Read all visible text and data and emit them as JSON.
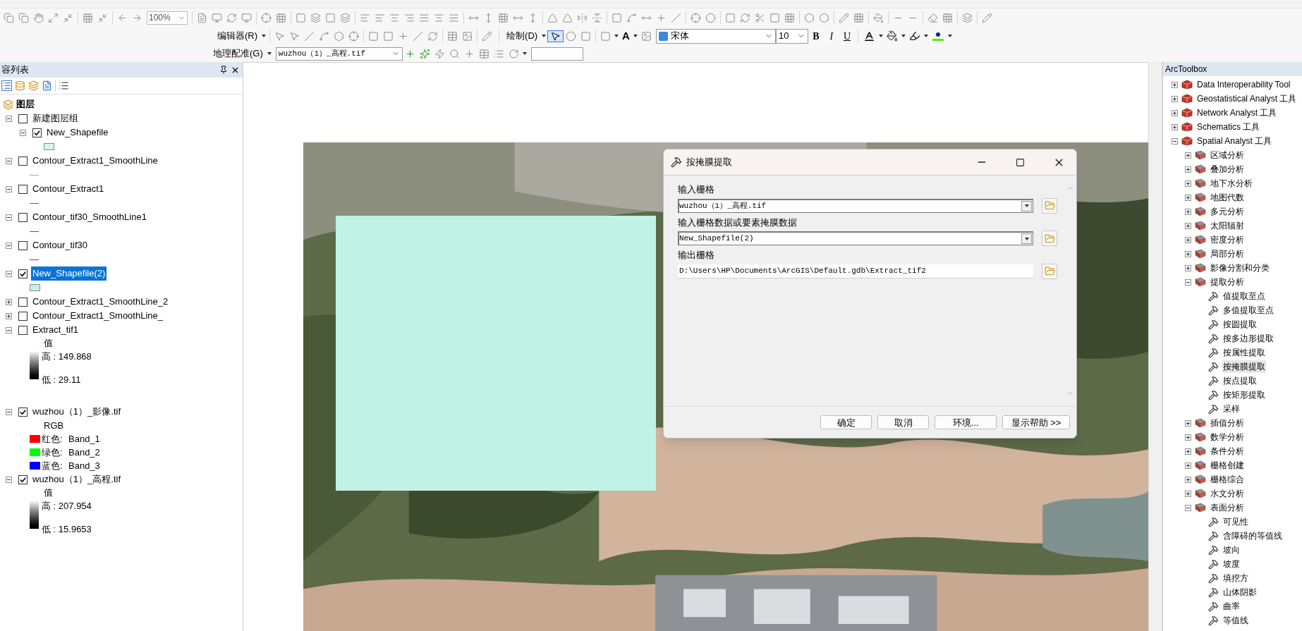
{
  "toolbar": {
    "zoom": "100%",
    "editor_menu": "编辑器(R)",
    "draw_menu": "绘制(D)",
    "text_tool": "A",
    "font": "宋体",
    "font_size": "10",
    "format": [
      "B",
      "I",
      "U"
    ],
    "georef_menu": "地理配准(G)",
    "georef_layer": "wuzhou（1）_高程.tif"
  },
  "toc": {
    "title": "容列表",
    "root": "图层",
    "layers": [
      {
        "name": "新建图层组",
        "kind": "group",
        "expanded": true,
        "checked": false,
        "selected": false,
        "children": [
          {
            "name": "New_Shapefile",
            "kind": "fill",
            "expanded": true,
            "checked": true,
            "selected": false,
            "color": "#d2f5f5"
          }
        ]
      },
      {
        "name": "Contour_Extract1_SmoothLine",
        "kind": "line",
        "expanded": true,
        "checked": false,
        "selected": false,
        "color": "#a8a8a8"
      },
      {
        "name": "Contour_Extract1",
        "kind": "line",
        "expanded": true,
        "checked": false,
        "selected": false,
        "color": "#c0401c"
      },
      {
        "name": "Contour_tif30_SmoothLine1",
        "kind": "line",
        "expanded": true,
        "checked": false,
        "selected": false,
        "color": "#a0420e"
      },
      {
        "name": "Contour_tif30",
        "kind": "line",
        "expanded": true,
        "checked": false,
        "selected": false,
        "color": "#c01870"
      },
      {
        "name": "New_Shapefile(2)",
        "kind": "fill",
        "expanded": true,
        "checked": true,
        "selected": true,
        "color": "#c2f2e2"
      },
      {
        "name": "Contour_Extract1_SmoothLine_2",
        "expanded": false,
        "checked": false,
        "selected": false
      },
      {
        "name": "Contour_Extract1_SmoothLine_",
        "expanded": false,
        "checked": false,
        "selected": false
      },
      {
        "name": "Extract_tif1",
        "kind": "stretch",
        "expanded": true,
        "checked": false,
        "selected": false,
        "field": "值",
        "high": "高 : 149.868",
        "low": "低 : 29.11"
      },
      {
        "name": "wuzhou（1）_影像.tif",
        "kind": "rgb",
        "expanded": true,
        "checked": true,
        "selected": false,
        "title": "RGB",
        "bands": [
          {
            "color": "#ff0000",
            "channel": "红色:",
            "band": "Band_1"
          },
          {
            "color": "#00ff00",
            "channel": "绿色:",
            "band": "Band_2"
          },
          {
            "color": "#0000ff",
            "channel": "蓝色:",
            "band": "Band_3"
          }
        ]
      },
      {
        "name": "wuzhou（1）_高程.tif",
        "kind": "stretch",
        "expanded": true,
        "checked": true,
        "selected": false,
        "field": "值",
        "high": "高 : 207.954",
        "low": "低 : 15.9653"
      }
    ]
  },
  "dialog": {
    "title": "按掩膜提取",
    "params": [
      {
        "label": "输入栅格",
        "value": "wuzhou（1）_高程.tif",
        "kind": "combo"
      },
      {
        "label": "输入栅格数据或要素掩膜数据",
        "value": "New_Shapefile(2)",
        "kind": "combo"
      },
      {
        "label": "输出栅格",
        "value": "D:\\Users\\HP\\Documents\\ArcGIS\\Default.gdb\\Extract_tif2",
        "kind": "text"
      }
    ],
    "buttons": [
      "确定",
      "取消",
      "环境...",
      "显示帮助 >>"
    ]
  },
  "toolbox": {
    "title": "ArcToolbox",
    "items": [
      {
        "name": "Data Interoperability Tool",
        "kind": "toolbox",
        "expanded": false
      },
      {
        "name": "Geostatistical Analyst 工具",
        "kind": "toolbox",
        "expanded": false
      },
      {
        "name": "Network Analyst 工具",
        "kind": "toolbox",
        "expanded": false
      },
      {
        "name": "Schematics 工具",
        "kind": "toolbox",
        "expanded": false
      },
      {
        "name": "Spatial Analyst 工具",
        "kind": "toolbox",
        "expanded": true,
        "children": [
          {
            "name": "区域分析",
            "kind": "toolset",
            "expanded": false
          },
          {
            "name": "叠加分析",
            "kind": "toolset",
            "expanded": false
          },
          {
            "name": "地下水分析",
            "kind": "toolset",
            "expanded": false
          },
          {
            "name": "地图代数",
            "kind": "toolset",
            "expanded": false
          },
          {
            "name": "多元分析",
            "kind": "toolset",
            "expanded": false
          },
          {
            "name": "太阳辐射",
            "kind": "toolset",
            "expanded": false
          },
          {
            "name": "密度分析",
            "kind": "toolset",
            "expanded": false
          },
          {
            "name": "局部分析",
            "kind": "toolset",
            "expanded": false
          },
          {
            "name": "影像分割和分类",
            "kind": "toolset",
            "expanded": false
          },
          {
            "name": "提取分析",
            "kind": "toolset",
            "expanded": true,
            "children": [
              {
                "name": "值提取至点",
                "kind": "tool",
                "selected": false
              },
              {
                "name": "多值提取至点",
                "kind": "tool",
                "selected": false
              },
              {
                "name": "按圆提取",
                "kind": "tool",
                "selected": false
              },
              {
                "name": "按多边形提取",
                "kind": "tool",
                "selected": false
              },
              {
                "name": "按属性提取",
                "kind": "tool",
                "selected": false
              },
              {
                "name": "按掩膜提取",
                "kind": "tool",
                "selected": true
              },
              {
                "name": "按点提取",
                "kind": "tool",
                "selected": false
              },
              {
                "name": "按矩形提取",
                "kind": "tool",
                "selected": false
              },
              {
                "name": "采样",
                "kind": "tool",
                "selected": false
              }
            ]
          },
          {
            "name": "插值分析",
            "kind": "toolset",
            "expanded": false
          },
          {
            "name": "数学分析",
            "kind": "toolset",
            "expanded": false
          },
          {
            "name": "条件分析",
            "kind": "toolset",
            "expanded": false
          },
          {
            "name": "栅格创建",
            "kind": "toolset",
            "expanded": false
          },
          {
            "name": "栅格综合",
            "kind": "toolset",
            "expanded": false
          },
          {
            "name": "水文分析",
            "kind": "toolset",
            "expanded": false
          },
          {
            "name": "表面分析",
            "kind": "toolset",
            "expanded": true,
            "children": [
              {
                "name": "可见性",
                "kind": "tool",
                "selected": false
              },
              {
                "name": "含障碍的等值线",
                "kind": "tool",
                "selected": false
              },
              {
                "name": "坡向",
                "kind": "tool",
                "selected": false
              },
              {
                "name": "坡度",
                "kind": "tool",
                "selected": false
              },
              {
                "name": "填挖方",
                "kind": "tool",
                "selected": false
              },
              {
                "name": "山体阴影",
                "kind": "tool",
                "selected": false
              },
              {
                "name": "曲率",
                "kind": "tool",
                "selected": false
              },
              {
                "name": "等值线",
                "kind": "tool",
                "selected": false
              }
            ]
          }
        ]
      }
    ]
  }
}
